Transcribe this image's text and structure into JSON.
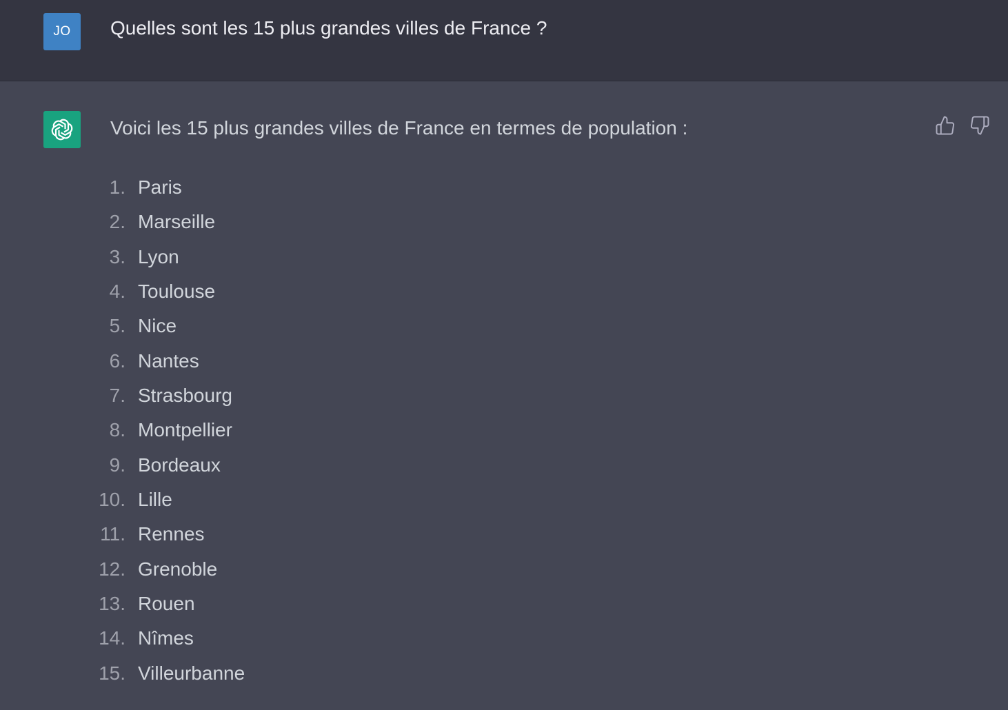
{
  "user": {
    "avatar_initials": "JO",
    "message": "Quelles sont les 15 plus grandes villes de France ?"
  },
  "assistant": {
    "avatar_icon": "openai-logo-icon",
    "intro": "Voici les 15 plus grandes villes de France en termes de population :",
    "cities": [
      {
        "num": "1.",
        "name": "Paris"
      },
      {
        "num": "2.",
        "name": "Marseille"
      },
      {
        "num": "3.",
        "name": "Lyon"
      },
      {
        "num": "4.",
        "name": "Toulouse"
      },
      {
        "num": "5.",
        "name": "Nice"
      },
      {
        "num": "6.",
        "name": "Nantes"
      },
      {
        "num": "7.",
        "name": "Strasbourg"
      },
      {
        "num": "8.",
        "name": "Montpellier"
      },
      {
        "num": "9.",
        "name": "Bordeaux"
      },
      {
        "num": "10.",
        "name": "Lille"
      },
      {
        "num": "11.",
        "name": "Rennes"
      },
      {
        "num": "12.",
        "name": "Grenoble"
      },
      {
        "num": "13.",
        "name": "Rouen"
      },
      {
        "num": "14.",
        "name": "Nîmes"
      },
      {
        "num": "15.",
        "name": "Villeurbanne"
      }
    ],
    "feedback": {
      "up_icon": "thumbs-up-icon",
      "down_icon": "thumbs-down-icon"
    }
  },
  "colors": {
    "user_bg": "#343541",
    "assistant_bg": "#444654",
    "user_avatar": "#3f82c4",
    "bot_avatar": "#19a37f"
  }
}
